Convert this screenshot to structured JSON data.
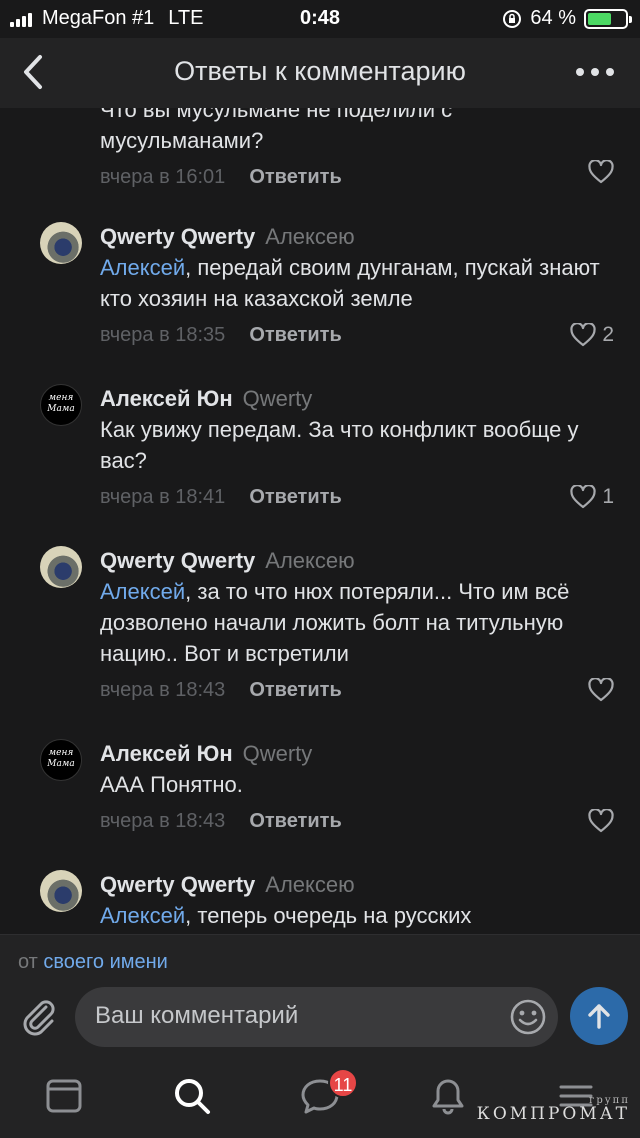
{
  "status_bar": {
    "carrier": "MegaFon #1",
    "network": "LTE",
    "time": "0:48",
    "battery_percent": "64 %",
    "battery_level": 0.64
  },
  "header": {
    "title": "Ответы к комментарию",
    "back_icon": "chevron-left-icon",
    "more_icon": "more-horizontal-icon"
  },
  "comments": [
    {
      "author": "",
      "reply_to": "",
      "mention": "",
      "text": "Что вы мусульмане не поделили с мусульманами?",
      "time": "вчера в 16:01",
      "reply_label": "Ответить",
      "likes": ""
    },
    {
      "author": "Qwerty Qwerty",
      "reply_to": "Алексею",
      "mention": "Алексей",
      "text": ", передай своим дунганам, пускай знают кто хозяин на казахской земле",
      "time": "вчера в 18:35",
      "reply_label": "Ответить",
      "likes": "2"
    },
    {
      "author": "Алексей Юн",
      "reply_to": "Qwerty",
      "mention": "",
      "text": "Как увижу передам. За что конфликт вообще у вас?",
      "time": "вчера в 18:41",
      "reply_label": "Ответить",
      "likes": "1"
    },
    {
      "author": "Qwerty Qwerty",
      "reply_to": "Алексею",
      "mention": "Алексей",
      "text": ", за то что нюх потеряли... Что им всё дозволено начали ложить болт на титульную нацию.. Вот и встретили",
      "time": "вчера в 18:43",
      "reply_label": "Ответить",
      "likes": ""
    },
    {
      "author": "Алексей Юн",
      "reply_to": "Qwerty",
      "mention": "",
      "text": "ААА Понятно.",
      "time": "вчера в 18:43",
      "reply_label": "Ответить",
      "likes": ""
    },
    {
      "author": "Qwerty Qwerty",
      "reply_to": "Алексею",
      "mention": "Алексей",
      "text": ", теперь очередь на русских",
      "time": "",
      "reply_label": "",
      "likes": ""
    }
  ],
  "avatar_alex_text": "меня Мама",
  "composer": {
    "as_prefix": "от",
    "as_link": "своего имени",
    "placeholder": "Ваш комментарий"
  },
  "tabbar": {
    "messages_badge": "11"
  },
  "watermark": {
    "small": "групп",
    "main": "КОМПРОМАТ"
  },
  "colors": {
    "background": "#19191a",
    "header": "#232324",
    "link": "#71aaeb",
    "send_button": "#2c6aa9",
    "badge": "#e64646"
  }
}
